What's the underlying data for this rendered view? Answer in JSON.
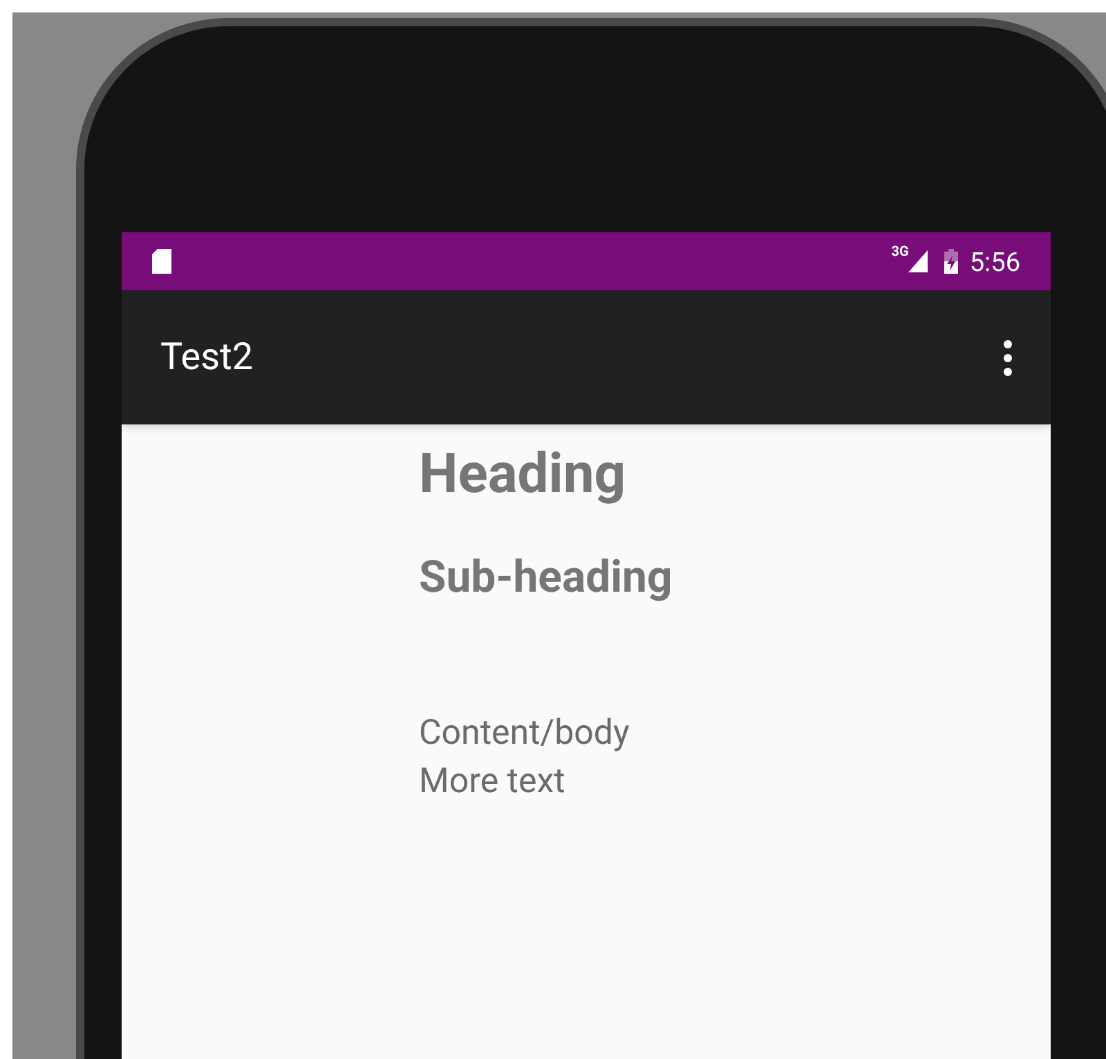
{
  "status_bar": {
    "network_type": "3G",
    "time": "5:56"
  },
  "app_bar": {
    "title": "Test2"
  },
  "content": {
    "heading": "Heading",
    "subheading": "Sub-heading",
    "body": [
      "Content/body",
      "More text"
    ]
  }
}
